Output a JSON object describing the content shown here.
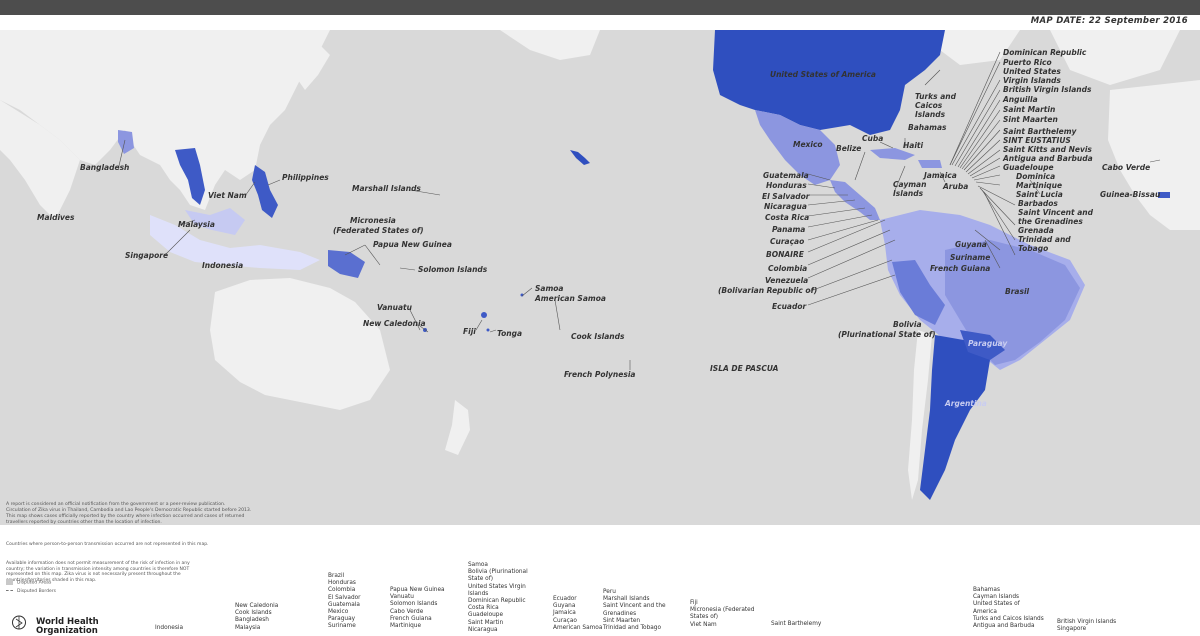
{
  "header": {
    "map_date": "MAP DATE: 22 September 2016"
  },
  "colors": {
    "ocean": "#d9d9d9",
    "land": "#f0f0f0",
    "dark_blue": "#2f4fbf",
    "mid_blue": "#8c96e0",
    "light_blue": "#c6caf2",
    "pale_blue": "#dfe1fa"
  },
  "map_labels": {
    "usa": "United States of America",
    "mexico": "Mexico",
    "brazil": "Brasil",
    "argentina": "Argentina",
    "paraguay": "Paraguay",
    "bangladesh": "Bangladesh",
    "maldives": "Maldives",
    "viet_nam": "Viet Nam",
    "philippines": "Philippines",
    "malaysia": "Malaysia",
    "singapore": "Singapore",
    "indonesia": "Indonesia",
    "marshall": "Marshall Islands",
    "micronesia": "Micronesia\n(Federated States of)",
    "micronesia_1": "Micronesia",
    "micronesia_2": "(Federated States of)",
    "png": "Papua New Guinea",
    "solomon": "Solomon Islands",
    "vanuatu": "Vanuatu",
    "new_caledonia": "New Caledonia",
    "fiji": "Fiji",
    "tonga": "Tonga",
    "samoa": "Samoa",
    "american_samoa": "American Samoa",
    "cook": "Cook Islands",
    "french_polynesia": "French Polynesia",
    "isla_pascua": "ISLA DE PASCUA",
    "cabo_verde": "Cabo Verde",
    "guinea_bissau": "Guinea-Bissau",
    "guatemala": "Guatemala",
    "honduras": "Honduras",
    "el_salvador": "El Salvador",
    "nicaragua": "Nicaragua",
    "costa_rica": "Costa Rica",
    "panama": "Panama",
    "curacao": "Curaçao",
    "bonaire": "BONAIRE",
    "colombia": "Colombia",
    "venezuela_1": "Venezuela",
    "venezuela_2": "(Bolivarian Republic of)",
    "ecuador": "Ecuador",
    "belize": "Belize",
    "cuba": "Cuba",
    "bahamas": "Bahamas",
    "turks_1": "Turks and",
    "turks_2": "Caicos",
    "turks_3": "Islands",
    "haiti": "Haiti",
    "jamaica": "Jamaica",
    "cayman_1": "Cayman",
    "cayman_2": "Islands",
    "aruba": "Aruba",
    "guyana": "Guyana",
    "suriname": "Suriname",
    "french_guiana": "French Guiana",
    "bolivia_1": "Bolivia",
    "bolivia_2": "(Plurinational State of)",
    "carib_list": [
      "Dominican Republic",
      "Puerto Rico",
      "United States",
      "Virgin Islands",
      "British Virgin Islands",
      "Anguilla",
      "Saint Martin",
      "Sint Maarten",
      "Saint Barthelemy",
      "SINT EUSTATIUS",
      "Saint Kitts and Nevis",
      "Antigua and Barbuda",
      "Guadeloupe",
      "Dominica",
      "Martinique",
      "Saint Lucia",
      "Barbados",
      "Saint Vincent and",
      "the Grenadines",
      "Grenada",
      "Trinidad and",
      "Tobago"
    ]
  },
  "notes": {
    "line1": "A report is considered an official notification from the government or a peer-review publication.",
    "line2": "Circulation of Zika virus in Thailand, Cambodia and Lao People's Democratic Republic started before 2013.",
    "line3": "This map shows cases officially reported by the country where infection occurred and cases of returned",
    "line4": "travellers reported by countries other than the location of infection.",
    "line5": "Countries where person-to-person transmission occurred are not represented in this map.",
    "line6": "Available information does not permit measurement of the risk of infection in any country; the variation in",
    "line7": "transmission intensity among countries is therefore NOT represented on this map. Zika virus is not necessarily",
    "line8": "present throughout the countries/territories shaded in this map."
  },
  "legend": {
    "disputed_areas": "Disputed Areas",
    "disputed_borders": "Disputed Borders"
  },
  "footer_lists": {
    "col_a": [
      "New Caledonia",
      "Cook Islands",
      "Bangladesh",
      "Malaysia"
    ],
    "col_b": [
      "Indonesia"
    ],
    "col_c": [
      "Brazil",
      "Honduras",
      "Colombia",
      "El Salvador",
      "Guatemala",
      "Mexico",
      "Paraguay",
      "Suriname"
    ],
    "col_d": [
      "Papua New Guinea",
      "Vanuatu",
      "Solomon Islands",
      "Cabo Verde",
      "French Guiana",
      "Martinique"
    ],
    "col_e": [
      "Samoa",
      "Bolivia (Plurinational",
      "State of)",
      "United States Virgin",
      "Islands",
      "Dominican Republic",
      "Costa Rica",
      "Guadeloupe",
      "Saint Martin",
      "Nicaragua"
    ],
    "col_f": [
      "Ecuador",
      "Guyana",
      "Jamaica",
      "Curaçao",
      "American Samoa"
    ],
    "col_g": [
      "Peru",
      "Marshall Islands",
      "Saint Vincent and the",
      "Grenadines",
      "Sint Maarten",
      "Trinidad and Tobago"
    ],
    "col_h": [
      "Fiji",
      "Micronesia (Federated",
      "States of)",
      "Viet Nam"
    ],
    "col_i": [
      "Saint Barthelemy"
    ],
    "col_j": [
      "Bahamas",
      "Cayman Islands",
      "United States of",
      "America",
      "Turks and Caicos Islands",
      "Antigua and Barbuda"
    ],
    "col_k": [
      "British Virgin Islands",
      "Singapore"
    ]
  },
  "who": {
    "name": "World Health",
    "name2": "Organization"
  }
}
